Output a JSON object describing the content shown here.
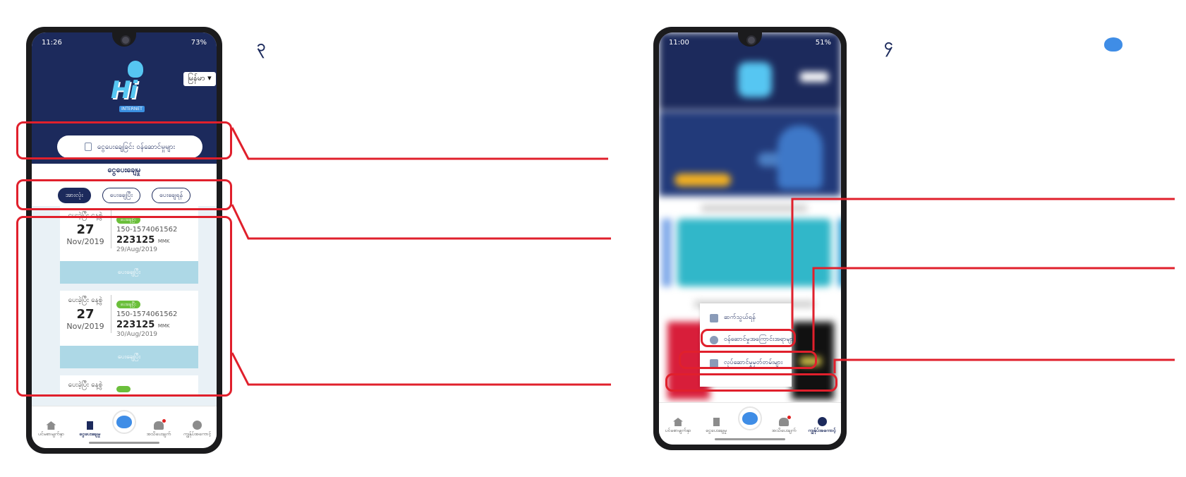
{
  "steps": {
    "first": "၃",
    "second": "၄"
  },
  "phone1": {
    "status_time": "11:26",
    "status_right": "73%",
    "language": "မြန်မာ ▾",
    "logo_text": "Hi",
    "logo_sub": "INTERNET",
    "top_button": "ငွေပေးချေခြင်း ဝန်ဆောင်မှုများ",
    "section_title": "ငွေပေးချေမှု",
    "filters": [
      "အားလုံး",
      "ပေးချေပြီး",
      "ပေးချေရန်"
    ],
    "cards": [
      {
        "label": "ပေးခဲ့ပြီး နေ့စွဲ",
        "day": "27",
        "month": "Nov/2019",
        "badge": "ပေးချေပြီး",
        "account": "150-1574061562",
        "amount": "223125",
        "currency": "MMK",
        "date": "29/Aug/2019",
        "button": "ပေးချေပြီး"
      },
      {
        "label": "ပေးခဲ့ပြီး နေ့စွဲ",
        "day": "27",
        "month": "Nov/2019",
        "badge": "ပေးချေပြီး",
        "account": "150-1574061562",
        "amount": "223125",
        "currency": "MMK",
        "date": "30/Aug/2019",
        "button": "ပေးချေပြီး"
      }
    ],
    "peek_label": "ပေးခဲ့ပြီး နေ့စွဲ",
    "nav": [
      "ပင်မစာမျက်နှာ",
      "ငွေပေးချေမှု",
      "",
      "အသိပေးချက်",
      "ကျွန်ုပ်အကောင့်"
    ]
  },
  "phone2": {
    "status_time": "11:00",
    "status_right": "51%",
    "menu": [
      "ဆက်သွယ်ရန်",
      "ဝန်ဆောင်မှုအကြောင်းအရာများ",
      "လုပ်ဆောင်မှုမှတ်တမ်းများ"
    ],
    "nav": [
      "ပင်မစာမျက်နှာ",
      "ငွေပေးချေမှု",
      "",
      "အသိပေးချက်",
      "ကျွန်ုပ်အကောင့်"
    ]
  },
  "colors": {
    "navy": "#1c2a5c",
    "highlight": "#e0202c",
    "paid_button": "#add8e6",
    "badge_green": "#6bbf3b"
  },
  "icons": [
    "home-icon",
    "payment-icon",
    "paw-icon",
    "bell-icon",
    "user-icon",
    "phone-icon",
    "question-icon",
    "document-icon"
  ]
}
